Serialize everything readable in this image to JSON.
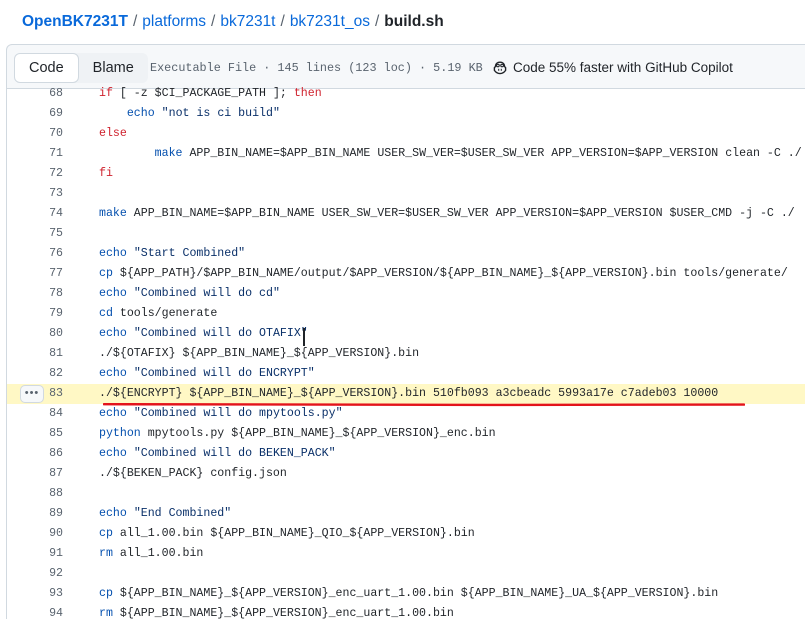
{
  "breadcrumb": {
    "repo": "OpenBK7231T",
    "sep": "/",
    "parts": [
      "platforms",
      "bk7231t",
      "bk7231t_os"
    ],
    "file": "build.sh"
  },
  "toolbar": {
    "code_label": "Code",
    "blame_label": "Blame",
    "file_info": "Executable File · 145 lines (123 loc) · 5.19 KB",
    "copilot_label": "Code 55% faster with GitHub Copilot"
  },
  "code": {
    "highlighted_line": 83,
    "lines": [
      {
        "n": "68",
        "t": "if [ -z $CI_PACKAGE_PATH ]; then"
      },
      {
        "n": "69",
        "t": "    echo \"not is ci build\""
      },
      {
        "n": "70",
        "t": "else"
      },
      {
        "n": "71",
        "t": "        make APP_BIN_NAME=$APP_BIN_NAME USER_SW_VER=$USER_SW_VER APP_VERSION=$APP_VERSION clean -C ./"
      },
      {
        "n": "72",
        "t": "fi"
      },
      {
        "n": "73",
        "t": ""
      },
      {
        "n": "74",
        "t": "make APP_BIN_NAME=$APP_BIN_NAME USER_SW_VER=$USER_SW_VER APP_VERSION=$APP_VERSION $USER_CMD -j -C ./"
      },
      {
        "n": "75",
        "t": ""
      },
      {
        "n": "76",
        "t": "echo \"Start Combined\""
      },
      {
        "n": "77",
        "t": "cp ${APP_PATH}/$APP_BIN_NAME/output/$APP_VERSION/${APP_BIN_NAME}_${APP_VERSION}.bin tools/generate/"
      },
      {
        "n": "78",
        "t": "echo \"Combined will do cd\""
      },
      {
        "n": "79",
        "t": "cd tools/generate"
      },
      {
        "n": "80",
        "t": "echo \"Combined will do OTAFIX\""
      },
      {
        "n": "81",
        "t": "./${OTAFIX} ${APP_BIN_NAME}_${APP_VERSION}.bin"
      },
      {
        "n": "82",
        "t": "echo \"Combined will do ENCRYPT\""
      },
      {
        "n": "83",
        "t": "./${ENCRYPT} ${APP_BIN_NAME}_${APP_VERSION}.bin 510fb093 a3cbeadc 5993a17e c7adeb03 10000"
      },
      {
        "n": "84",
        "t": "echo \"Combined will do mpytools.py\""
      },
      {
        "n": "85",
        "t": "python mpytools.py ${APP_BIN_NAME}_${APP_VERSION}_enc.bin"
      },
      {
        "n": "86",
        "t": "echo \"Combined will do BEKEN_PACK\""
      },
      {
        "n": "87",
        "t": "./${BEKEN_PACK} config.json"
      },
      {
        "n": "88",
        "t": ""
      },
      {
        "n": "89",
        "t": "echo \"End Combined\""
      },
      {
        "n": "90",
        "t": "cp all_1.00.bin ${APP_BIN_NAME}_QIO_${APP_VERSION}.bin"
      },
      {
        "n": "91",
        "t": "rm all_1.00.bin"
      },
      {
        "n": "92",
        "t": ""
      },
      {
        "n": "93",
        "t": "cp ${APP_BIN_NAME}_${APP_VERSION}_enc_uart_1.00.bin ${APP_BIN_NAME}_UA_${APP_VERSION}.bin"
      },
      {
        "n": "94",
        "t": "rm ${APP_BIN_NAME}_${APP_VERSION}_enc_uart_1.00.bin"
      }
    ]
  },
  "more_icon": "kebab-horizontal-icon",
  "annotation_color": "#e3131b",
  "highlight_color": "#fff8c5"
}
